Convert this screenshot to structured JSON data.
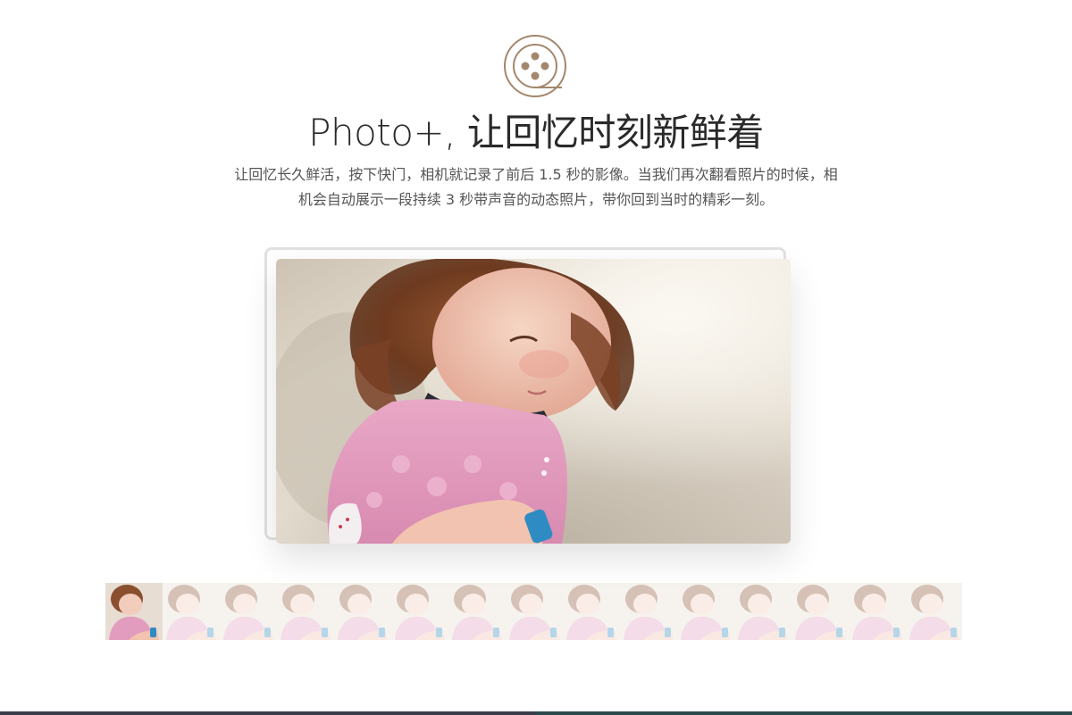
{
  "header": {
    "logo_icon": "film-reel-icon",
    "title": "Photo+, 让回忆时刻新鲜着",
    "desc_line1": "让回忆长久鲜活，按下快门，相机就记录了前后 1.5 秒的影像。当我们再次翻看照片的时候，相",
    "desc_line2": "机会自动展示一段持续 3 秒带声音的动态照片，带你回到当时的精彩一刻。"
  },
  "colors": {
    "logo": "#a3876d",
    "title": "#2a2a2a",
    "desc": "#555555",
    "frame_border": "#e1e1e1",
    "bottom_left": "#3b3d4a",
    "bottom_right": "#2c4a4c"
  },
  "photo": {
    "subject": "toddler-girl-photo"
  },
  "filmstrip": {
    "frame_count": 15,
    "active_index": 0
  }
}
